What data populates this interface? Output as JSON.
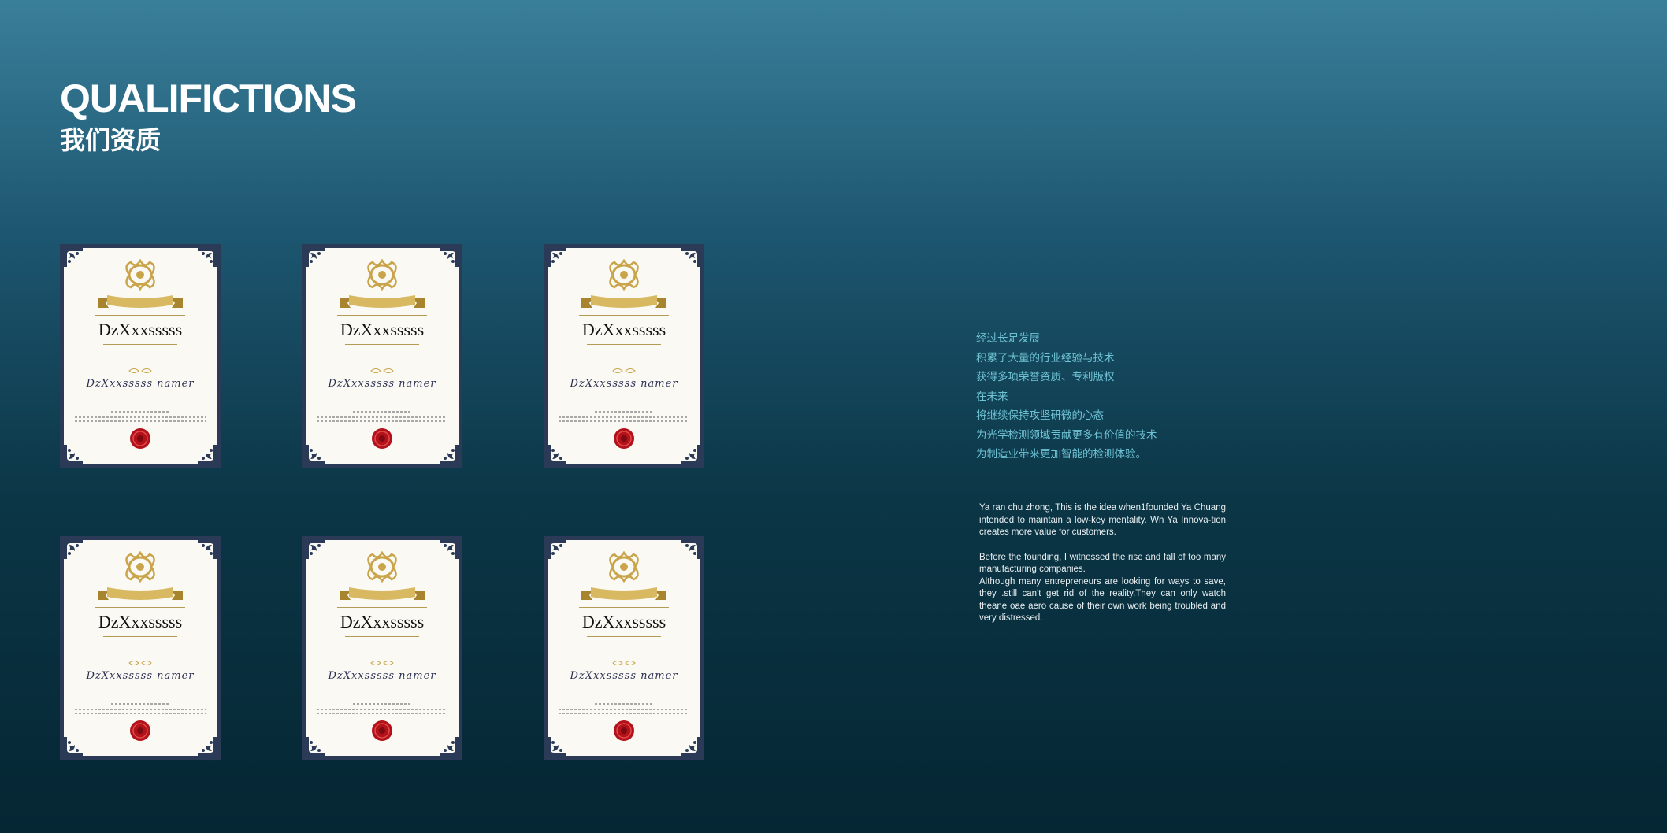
{
  "header": {
    "title_en": "QUALIFICTIONS",
    "title_cn": "我们资质"
  },
  "certificates": [
    {
      "name": "DzXxxsssss",
      "script": "DzXxxsssss namer"
    },
    {
      "name": "DzXxxsssss",
      "script": "DzXxxsssss namer"
    },
    {
      "name": "DzXxxsssss",
      "script": "DzXxxsssss namer"
    },
    {
      "name": "DzXxxsssss",
      "script": "DzXxxsssss namer"
    },
    {
      "name": "DzXxxsssss",
      "script": "DzXxxsssss namer"
    },
    {
      "name": "DzXxxsssss",
      "script": "DzXxxsssss namer"
    }
  ],
  "intro_cn": [
    "经过长足发展",
    "积累了大量的行业经验与技术",
    "获得多项荣誉资质、专利版权",
    "在未来",
    "将继续保持攻坚研微的心态",
    "为光学检测领域贡献更多有价值的技术",
    "为制造业带来更加智能的检测体验。"
  ],
  "intro_en": {
    "p1": "Ya ran chu zhong, This is the idea when1founded Ya Chuang intended to maintain a low-key mentality. Wn Ya Innova-tion creates more value for customers.",
    "p2": "Before the founding, I witnessed the rise and fall of too many manufacturing companies.",
    "p3": "Although many entrepreneurs are looking for ways to save, they .still can't get rid of the reality.They can only watch theane oae aero cause of their own work being troubled and very distressed."
  },
  "colors": {
    "cert_frame": "#2b3a56",
    "cert_paper": "#fbf9f3",
    "gold": "#c9a44a",
    "seal_red": "#b3121b",
    "cn_text": "#6fc3d6"
  }
}
